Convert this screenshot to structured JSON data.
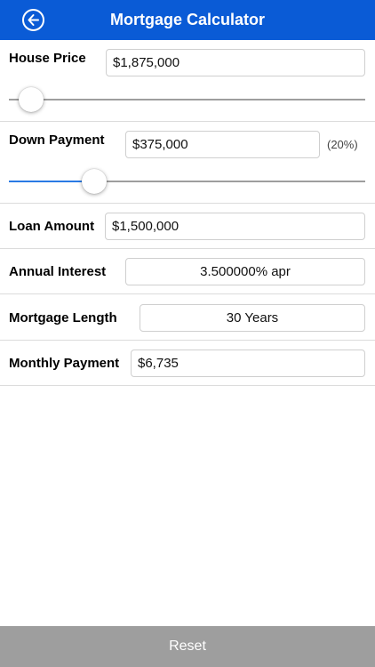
{
  "header": {
    "title": "Mortgage Calculator"
  },
  "house_price": {
    "label": "House Price",
    "value": "$1,875,000",
    "slider_level": 0.03
  },
  "down_payment": {
    "label": "Down Payment",
    "value": "$375,000",
    "percent": "(20%)",
    "slider_level": 0.22
  },
  "loan_amount": {
    "label": "Loan Amount",
    "value": "$1,500,000"
  },
  "annual_interest": {
    "label": "Annual Interest",
    "value": "3.500000% apr"
  },
  "mortgage_length": {
    "label": "Mortgage Length",
    "value": "30 Years"
  },
  "monthly_payment": {
    "label": "Monthly Payment",
    "value": "$6,735"
  },
  "footer": {
    "reset_label": "Reset"
  },
  "colors": {
    "header": "#0a5bd6",
    "slider_fill": "#2a7ae4",
    "reset_bar": "#9e9e9e"
  }
}
